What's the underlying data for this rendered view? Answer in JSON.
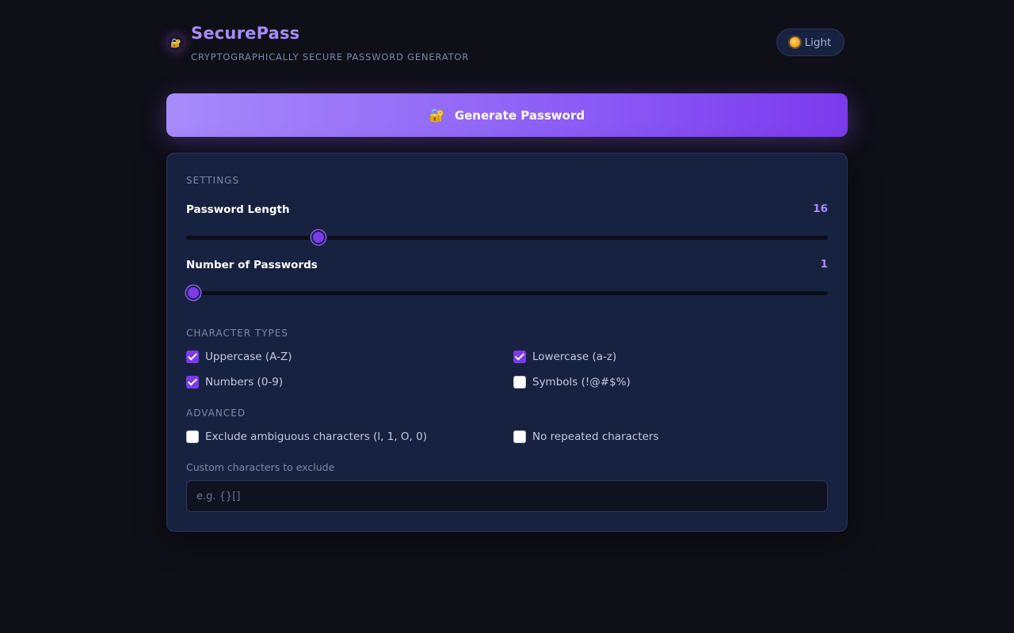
{
  "header": {
    "title": "SecurePass",
    "subtitle": "CRYPTOGRAPHICALLY SECURE PASSWORD GENERATOR",
    "brand_icon": "lock-icon",
    "theme_toggle_label": "Light",
    "theme_toggle_icon": "sun-icon"
  },
  "generate": {
    "label": "Generate Password",
    "icon": "lock-icon"
  },
  "settings": {
    "section_label": "SETTINGS",
    "length": {
      "label": "Password Length",
      "value": "16",
      "slider_fraction": 0.2
    },
    "count": {
      "label": "Number of Passwords",
      "value": "1",
      "slider_fraction": 0.0
    }
  },
  "character_types": {
    "section_label": "CHARACTER TYPES",
    "options": [
      {
        "label": "Uppercase (A-Z)",
        "checked": true
      },
      {
        "label": "Lowercase (a-z)",
        "checked": true
      },
      {
        "label": "Numbers (0-9)",
        "checked": true
      },
      {
        "label": "Symbols (!@#$%)",
        "checked": false
      }
    ]
  },
  "advanced": {
    "section_label": "ADVANCED",
    "options": [
      {
        "label": "Exclude ambiguous characters (l, 1, O, 0)",
        "checked": false
      },
      {
        "label": "No repeated characters",
        "checked": false
      }
    ],
    "custom_exclude": {
      "label": "Custom characters to exclude",
      "placeholder": "e.g. {}[]",
      "value": ""
    }
  },
  "colors": {
    "background": "#0f0f17",
    "panel": "#172240",
    "accent": "#8b5cf6",
    "accent_light": "#a78bfa"
  }
}
